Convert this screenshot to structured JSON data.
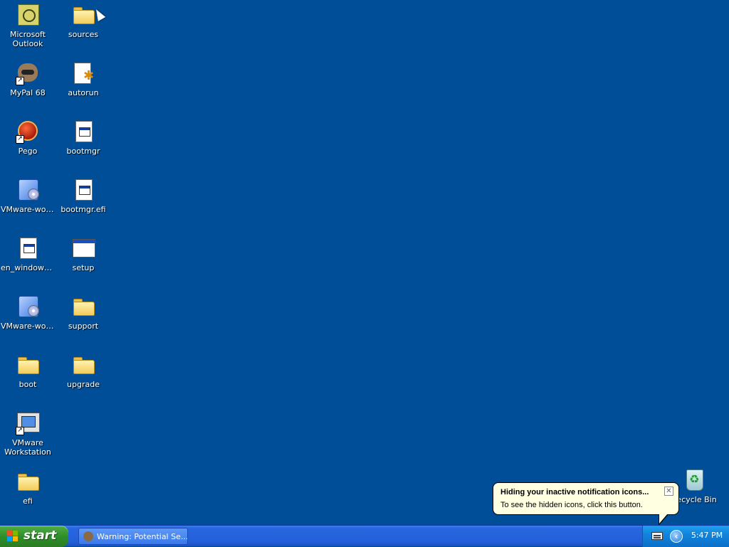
{
  "desktop": {
    "icons": [
      {
        "label": "Microsoft Outlook",
        "kind": "outlook-icon"
      },
      {
        "label": "sources",
        "kind": "folder-icon"
      },
      {
        "label": "MyPal 68",
        "kind": "mypal-icon"
      },
      {
        "label": "autorun",
        "kind": "autorun-icon"
      },
      {
        "label": "Pego",
        "kind": "pego-icon"
      },
      {
        "label": "bootmgr",
        "kind": "exe-file-icon"
      },
      {
        "label": "VMware-wor...",
        "kind": "installer-icon"
      },
      {
        "label": "bootmgr.efi",
        "kind": "exe-file-icon"
      },
      {
        "label": "en_windows...",
        "kind": "exe-file-icon"
      },
      {
        "label": "setup",
        "kind": "application-window-icon"
      },
      {
        "label": "VMware-wor...",
        "kind": "installer-icon"
      },
      {
        "label": "support",
        "kind": "folder-icon"
      },
      {
        "label": "boot",
        "kind": "folder-icon"
      },
      {
        "label": "upgrade",
        "kind": "folder-icon"
      },
      {
        "label": "VMware Workstation",
        "kind": "vmware-icon"
      },
      {
        "label": "efi",
        "kind": "folder-icon"
      },
      {
        "label": "Recycle Bin",
        "kind": "recycle-bin-icon"
      }
    ]
  },
  "balloon": {
    "title": "Hiding your inactive notification icons...",
    "text": "To see the hidden icons, click this button.",
    "close_glyph": "✕"
  },
  "taskbar": {
    "start_label": "start",
    "task_label": "Warning: Potential Se...",
    "clock": "5:47 PM",
    "chevron_glyph": "‹"
  },
  "colors": {
    "desktop_bg": "#004e98",
    "taskbar_blue": "#235fd8",
    "start_green": "#2f8f29",
    "tray_blue": "#1384db",
    "balloon_bg": "#ffffe1"
  }
}
